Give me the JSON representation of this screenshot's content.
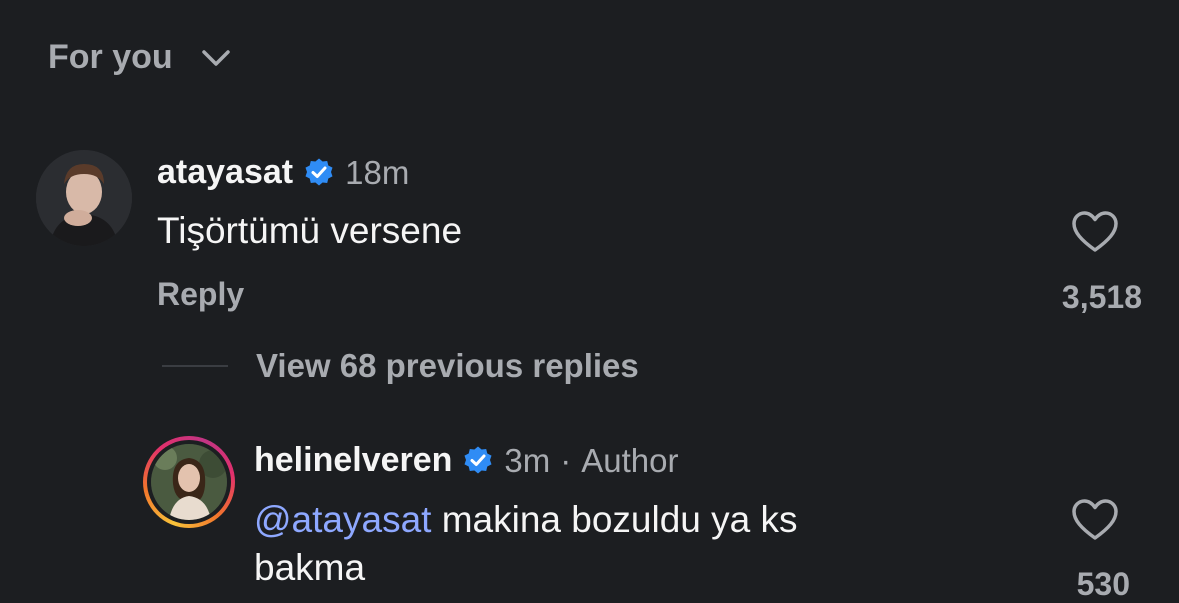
{
  "filter": {
    "label": "For you"
  },
  "comments": [
    {
      "username": "atayasat",
      "verified": true,
      "time": "18m",
      "text": "Tişörtümü versene",
      "reply_label": "Reply",
      "likes": "3,518"
    }
  ],
  "view_replies": {
    "label": "View 68 previous replies"
  },
  "reply": {
    "username": "helinelveren",
    "verified": true,
    "time": "3m",
    "separator": "·",
    "author_tag": "Author",
    "mention": "@atayasat",
    "text_line1": " makina bozuldu ya ks",
    "text_line2": "bakma",
    "likes": "530"
  },
  "colors": {
    "background": "#1c1e21",
    "secondary_text": "#a8abb0",
    "mention": "#8ea8ff",
    "verified": "#2f8cf5"
  }
}
